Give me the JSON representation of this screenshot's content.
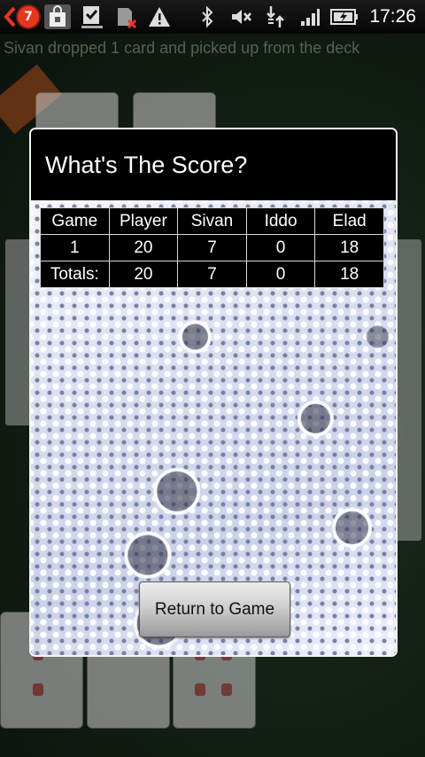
{
  "status_bar": {
    "notification_count": "7",
    "time": "17:26",
    "icons": [
      "notification-back-icon",
      "shopping-bag-icon",
      "download-check-icon",
      "sd-card-error-icon",
      "warning-icon",
      "bluetooth-icon",
      "mute-icon",
      "data-transfer-icon",
      "signal-icon",
      "battery-charging-icon"
    ]
  },
  "game": {
    "ticker": "Sivan dropped 1 card and picked up from the deck"
  },
  "dialog": {
    "title": "What's The Score?",
    "columns": [
      "Game",
      "Player",
      "Sivan",
      "Iddo",
      "Elad"
    ],
    "rows": [
      [
        "1",
        "20",
        "7",
        "0",
        "18"
      ],
      [
        "Totals:",
        "20",
        "7",
        "0",
        "18"
      ]
    ],
    "return_button": "Return to Game"
  }
}
